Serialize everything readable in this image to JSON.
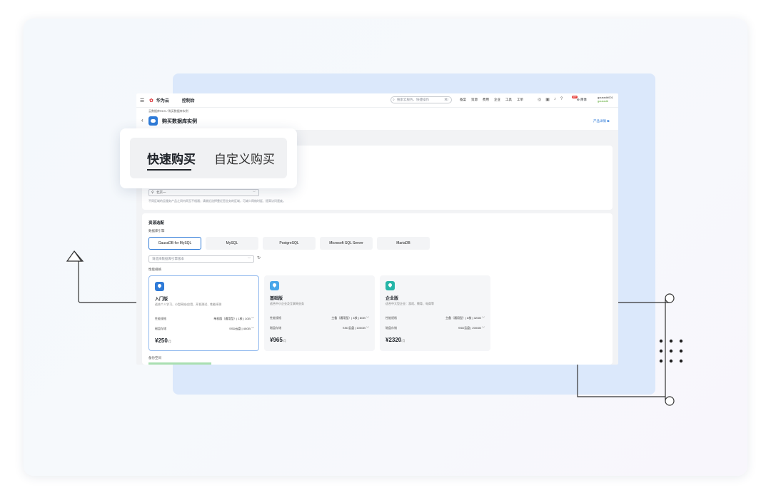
{
  "topbar": {
    "brand": "华为云",
    "console": "控制台",
    "search_placeholder": "搜索云服务、快捷操作",
    "search_shortcut": "⌘/",
    "links": [
      "备案",
      "资源",
      "费用",
      "企业",
      "工具",
      "工单"
    ],
    "notification_badge": "99+",
    "language": "简体",
    "account_name": "gaussdb001",
    "account_org": "gaussdb"
  },
  "subheader": {
    "breadcrumb": "云数据库RDS / 购买数据库实例",
    "title": "购买数据库实例",
    "help_link": "产品详情"
  },
  "purchase_tabs": {
    "quick": "快速购买",
    "custom": "自定义购买"
  },
  "region": {
    "value": "北京一",
    "note": "不同区域的云服务产品之间内网互不相通；请就近选择靠近您业务的区域，可减少网络时延、提高访问速度。"
  },
  "resource": {
    "title": "资源选配",
    "engine_label": "数据库引擎",
    "engines": [
      "GaussDB for MySQL",
      "MySQL",
      "PostgreSQL",
      "Microsoft SQL Server",
      "MariaDB"
    ],
    "version_placeholder": "请选择数据库引擎版本",
    "spec_label": "性能规格",
    "plans": [
      {
        "name": "入门版",
        "desc": "适合个人学习、小型网站/应用、开发测试、性能评测",
        "spec_key": "性能规格",
        "spec_value": "单机版（通用型）| 1核 | 1GB",
        "disk_key": "磁盘存储",
        "disk_value": "SSD云盘 | 40GB",
        "price": "¥250",
        "unit": "/月",
        "color": "#2f7bd8"
      },
      {
        "name": "基础版",
        "desc": "适合中小企业及互联网业务",
        "spec_key": "性能规格",
        "spec_value": "主备（通用型）| 4核 | 8GB",
        "disk_key": "磁盘存储",
        "disk_value": "SSD云盘 | 100GB",
        "price": "¥965",
        "unit": "/月",
        "color": "#49a6e9"
      },
      {
        "name": "企业版",
        "desc": "适合中大型企业：游戏、教育、电商等",
        "spec_key": "性能规格",
        "spec_value": "主备（通用型）| 8核 | 32GB",
        "disk_key": "磁盘存储",
        "disk_value": "SSD云盘 | 200GB",
        "price": "¥2320",
        "unit": "/月",
        "color": "#26b5a8"
      }
    ],
    "backup_label": "备份空间"
  }
}
